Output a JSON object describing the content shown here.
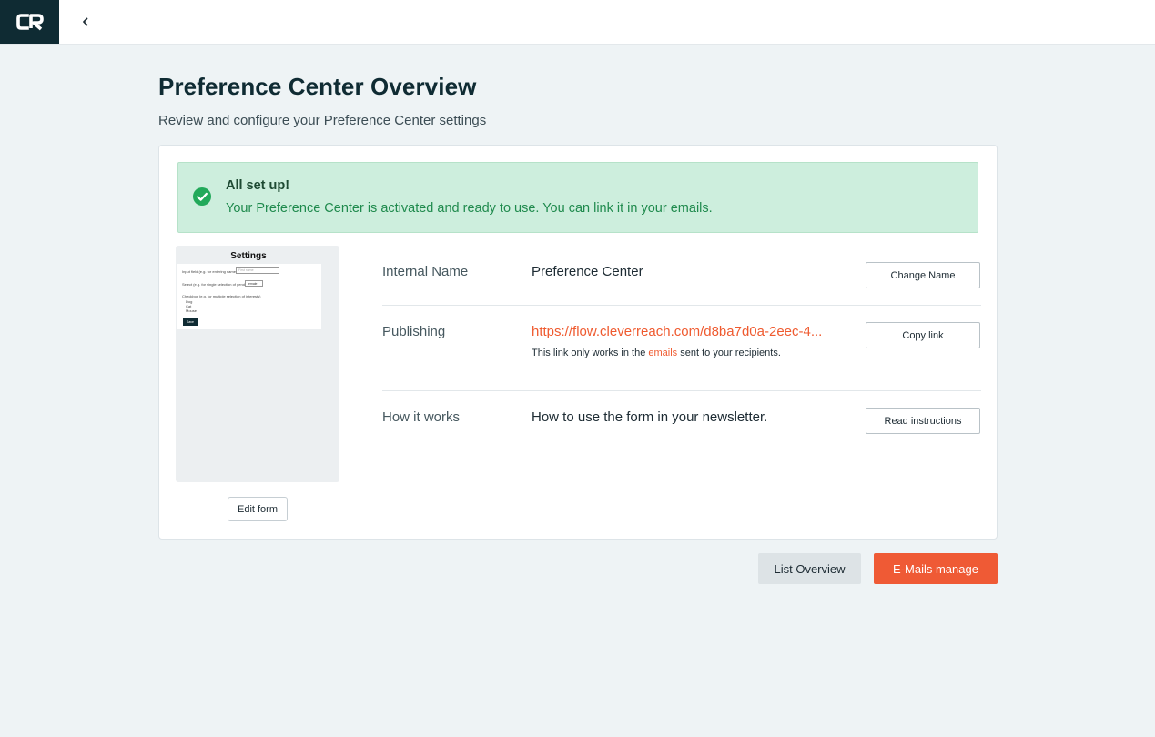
{
  "app": {
    "logo_text": "CR",
    "brand_color": "#0f2b33",
    "accent_color": "#ef5a35",
    "back_icon": "chevron-left-icon"
  },
  "header": {
    "title": "Preference Center Overview",
    "subtitle": "Review and configure your Preference Center settings"
  },
  "alert": {
    "icon": "check-circle-icon",
    "title": "All set up!",
    "message": "Your Preference Center is activated and ready to use. You can link it in your emails."
  },
  "preview": {
    "title": "Settings",
    "input_label": "Input field (e.g. for entering names)",
    "input_placeholder": "First name",
    "select_label": "Select (e.g. for single selection of gender)",
    "select_value": "female",
    "checkbox_label": "Checkbox (e.g. for multiple selection of interests)",
    "checkbox_options": [
      "Dog",
      "Cat",
      "Mouse"
    ],
    "save_label": "Save",
    "edit_button": "Edit form"
  },
  "details": {
    "internal_name": {
      "label": "Internal Name",
      "value": "Preference Center",
      "button": "Change Name"
    },
    "publishing": {
      "label": "Publishing",
      "link": "https://flow.cleverreach.com/d8ba7d0a-2eec-4...",
      "note_prefix": "This link only works in the ",
      "note_link": "emails",
      "note_suffix": " sent to your recipients.",
      "button": "Copy link"
    },
    "how_it_works": {
      "label": "How it works",
      "value": "How to use the form in your newsletter.",
      "button": "Read instructions"
    }
  },
  "footer": {
    "secondary_button": "List Overview",
    "primary_button": "E-Mails manage"
  }
}
